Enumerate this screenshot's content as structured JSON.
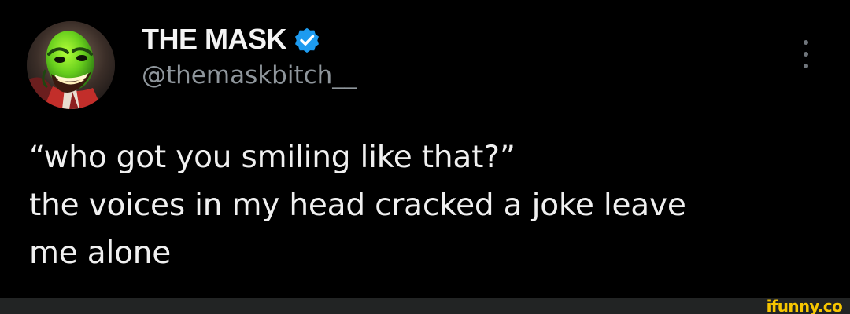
{
  "tweet": {
    "display_name": "THE MASK",
    "handle": "@themaskbitch__",
    "text_lines": [
      "“who got you smiling like that?”",
      "the voices in my head cracked a joke leave",
      "me alone"
    ]
  },
  "icons": {
    "avatar": "mask-avatar-icon",
    "verified": "verified-badge-icon",
    "more": "more-options-icon"
  },
  "watermark": {
    "brand": "ifunny.co"
  },
  "colors": {
    "background": "#000000",
    "text_primary": "#f0f0f0",
    "text_secondary": "#8f969c",
    "verified_blue": "#1d9bf0",
    "watermark_yellow": "#f7c600",
    "bottom_bar": "#222424"
  }
}
